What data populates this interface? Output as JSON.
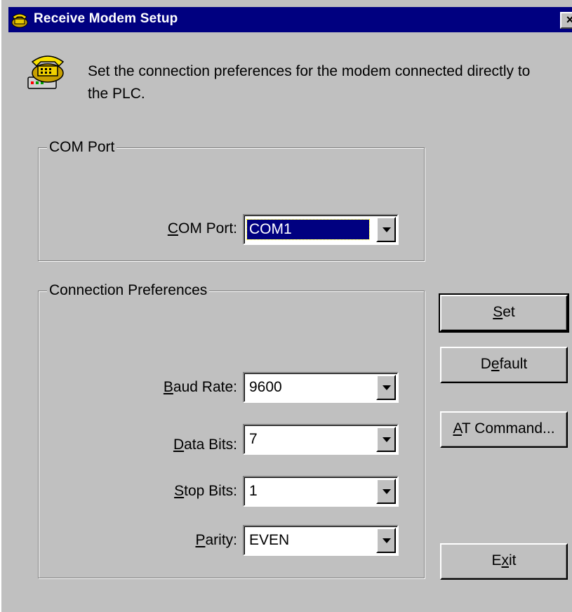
{
  "window": {
    "title": "Receive Modem Setup",
    "close_label": "×"
  },
  "intro": {
    "text": "Set the connection preferences for the modem connected directly to the PLC."
  },
  "com_port_group": {
    "legend": "COM Port",
    "label_underlined": "C",
    "label_rest": "OM Port:",
    "value": "COM1"
  },
  "connection_group": {
    "legend": "Connection Preferences",
    "fields": [
      {
        "label_underlined": "B",
        "label_rest": "aud Rate:",
        "value": "9600"
      },
      {
        "label_underlined": "D",
        "label_rest": "ata Bits:",
        "value": "7"
      },
      {
        "label_underlined": "S",
        "label_rest": "top Bits:",
        "value": "1"
      },
      {
        "label_underlined": "P",
        "label_rest": "arity:",
        "value": "EVEN"
      }
    ]
  },
  "buttons": {
    "set": {
      "pre": "",
      "underlined": "S",
      "post": "et"
    },
    "default": {
      "pre": "D",
      "underlined": "e",
      "post": "fault"
    },
    "at_command": {
      "pre": "",
      "underlined": "A",
      "post": "T Command..."
    },
    "exit": {
      "pre": "E",
      "underlined": "x",
      "post": "it"
    }
  },
  "colors": {
    "face": "#c0c0c0",
    "titlebar": "#000080",
    "selection": "#000080"
  },
  "icons": {
    "title": "telephone-icon",
    "header": "telephone-modem-icon"
  }
}
